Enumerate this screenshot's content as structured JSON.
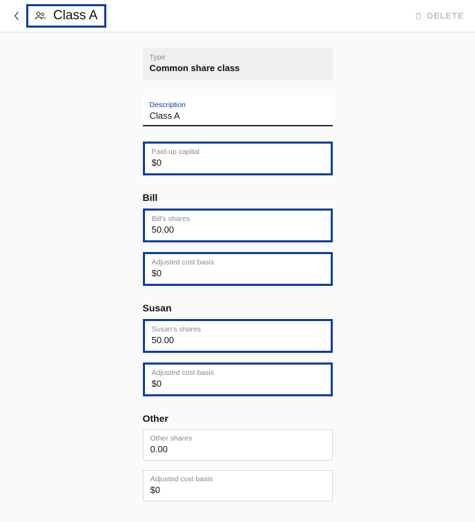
{
  "header": {
    "title": "Class A",
    "delete_label": "DELETE"
  },
  "type_field": {
    "label": "Type",
    "value": "Common share class"
  },
  "description_field": {
    "label": "Description",
    "value": "Class A"
  },
  "paid_up_capital": {
    "label": "Paid-up capital",
    "value": "$0"
  },
  "shareholders": [
    {
      "name": "Bill",
      "shares": {
        "label": "Bill's shares",
        "value": "50.00"
      },
      "acb": {
        "label": "Adjusted cost basis",
        "value": "$0"
      },
      "highlighted": true
    },
    {
      "name": "Susan",
      "shares": {
        "label": "Susan's shares",
        "value": "50.00"
      },
      "acb": {
        "label": "Adjusted cost basis",
        "value": "$0"
      },
      "highlighted": true
    },
    {
      "name": "Other",
      "shares": {
        "label": "Other shares",
        "value": "0.00"
      },
      "acb": {
        "label": "Adjusted cost basis",
        "value": "$0"
      },
      "highlighted": false
    }
  ]
}
